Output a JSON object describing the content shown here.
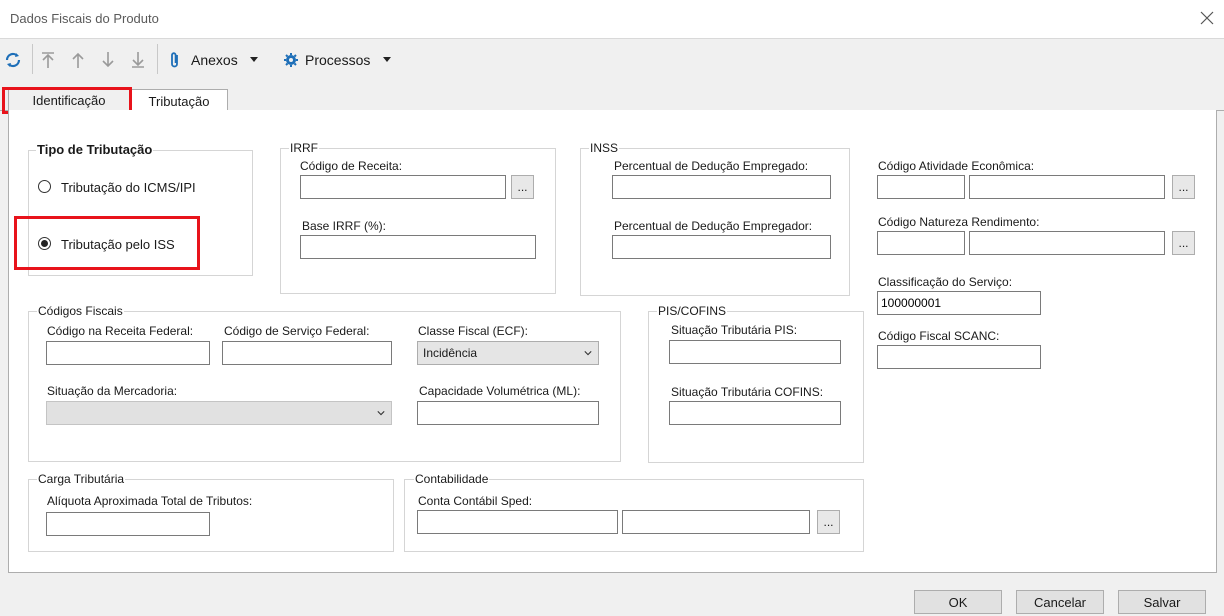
{
  "window": {
    "title": "Dados Fiscais do Produto"
  },
  "toolbar": {
    "anexos": "Anexos",
    "processos": "Processos"
  },
  "tabs": [
    {
      "label": "Identificação"
    },
    {
      "label": "Tributação"
    }
  ],
  "tipo_tributacao": {
    "title": "Tipo de Tributação",
    "options": [
      {
        "label": "Tributação do ICMS/IPI",
        "selected": false
      },
      {
        "label": "Tributação pelo ISS",
        "selected": true
      }
    ]
  },
  "irrf": {
    "title": "IRRF",
    "codigo_receita_label": "Código de Receita:",
    "codigo_receita_value": "",
    "base_label": "Base IRRF (%):",
    "base_value": ""
  },
  "inss": {
    "title": "INSS",
    "empregado_label": "Percentual de Dedução Empregado:",
    "empregador_label": "Percentual de Dedução Empregador:"
  },
  "right": {
    "atividade_label": "Código Atividade Econômica:",
    "natureza_label": "Código Natureza Rendimento:",
    "classificacao_label": "Classificação do Serviço:",
    "classificacao_value": "100000001",
    "scanc_label": "Código Fiscal SCANC:"
  },
  "codigos_fiscais": {
    "title": "Códigos Fiscais",
    "receita_federal_label": "Código na Receita Federal:",
    "servico_federal_label": "Código de Serviço Federal:",
    "classe_fiscal_label": "Classe Fiscal (ECF):",
    "classe_fiscal_value": "Incidência",
    "situacao_mercadoria_label": "Situação da Mercadoria:",
    "situacao_mercadoria_value": "",
    "capacidade_label": "Capacidade Volumétrica (ML):"
  },
  "pis_cofins": {
    "title": "PIS/COFINS",
    "pis_label": "Situação Tributária PIS:",
    "cofins_label": "Situação Tributária COFINS:"
  },
  "carga": {
    "title": "Carga Tributária",
    "aliquota_label": "Alíquota Aproximada Total de Tributos:"
  },
  "contabilidade": {
    "title": "Contabilidade",
    "conta_label": "Conta Contábil Sped:"
  },
  "footer": {
    "ok": "OK",
    "cancel": "Cancelar",
    "save": "Salvar"
  },
  "colors": {
    "highlight": "#e8131b",
    "accent_icon": "#1e6fb8"
  }
}
